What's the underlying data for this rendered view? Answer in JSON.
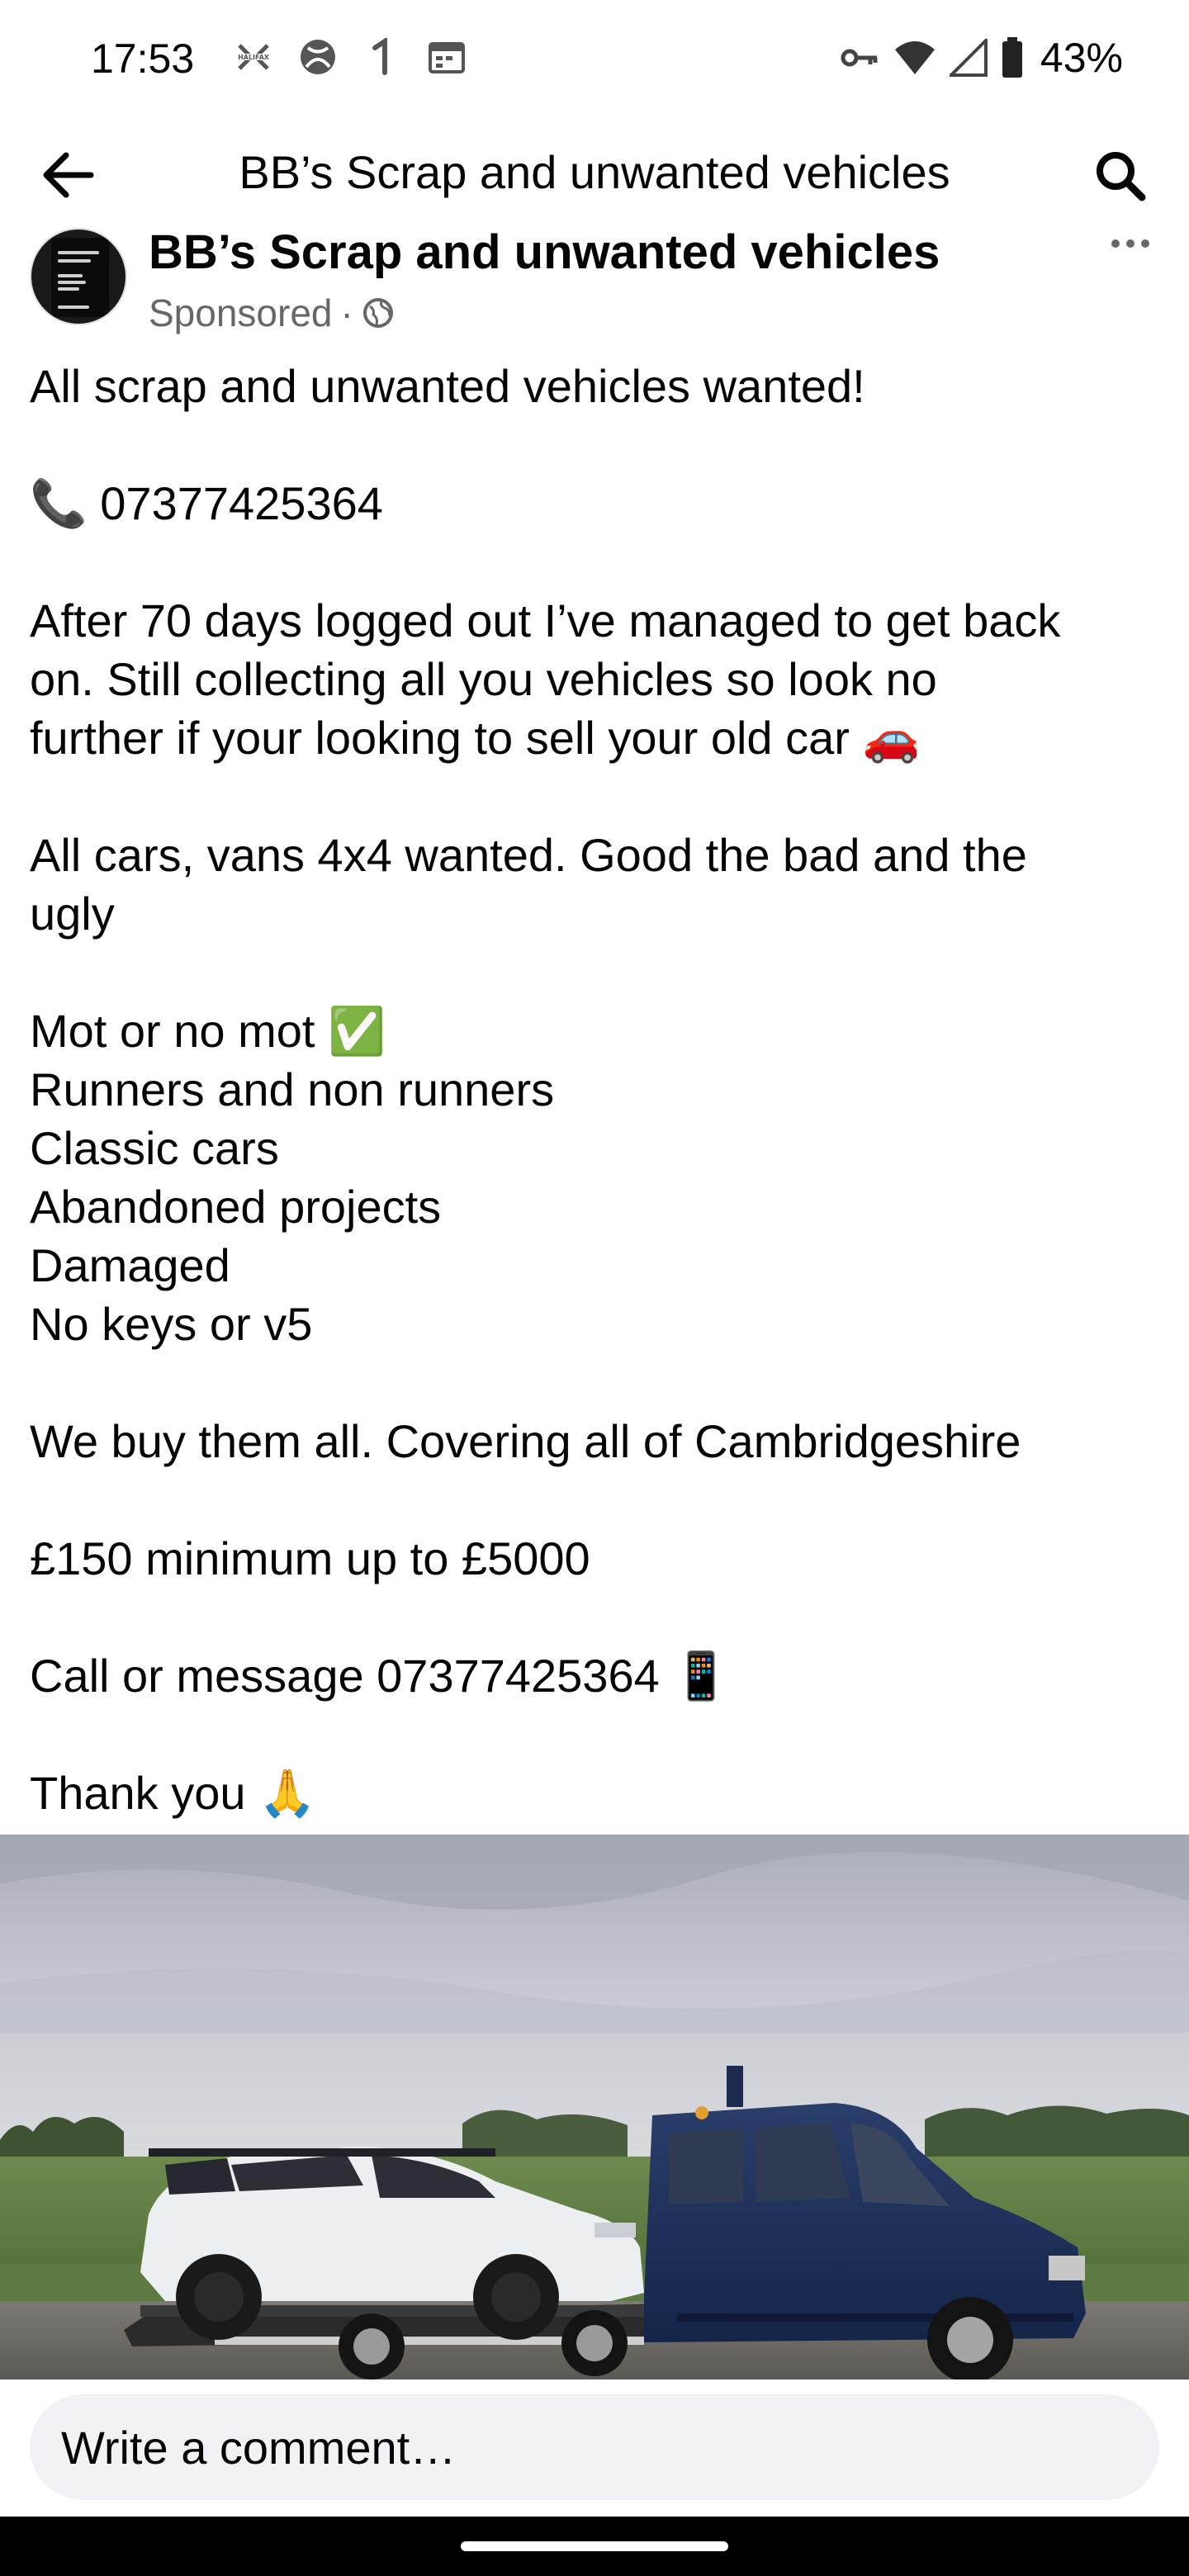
{
  "status_bar": {
    "time": "17:53",
    "left_icons": [
      "halifax-icon",
      "xbox-icon",
      "notification-icon",
      "calendar-icon"
    ],
    "right_icons": [
      "vpn-key-icon",
      "wifi-icon",
      "cell-signal-icon",
      "battery-icon"
    ],
    "battery_percent": "43%"
  },
  "header": {
    "title": "BB’s Scrap and unwanted vehicles"
  },
  "post": {
    "page_name": "BB’s Scrap and unwanted vehicles",
    "sponsored_label": "Sponsored",
    "separator": "·",
    "lines": [
      "All scrap and unwanted vehicles wanted!",
      "",
      "📞 07377425364",
      "",
      "After 70 days logged out I’ve managed to get back",
      "on. Still collecting all you vehicles so look no",
      "further if your looking to sell your old car 🚗",
      "",
      "All cars, vans 4x4 wanted. Good the bad and the",
      "ugly",
      "",
      "Mot or no mot ✅",
      "Runners and non runners",
      "Classic cars",
      "Abandoned projects",
      "Damaged",
      "No keys or v5",
      "",
      "We buy them all. Covering all of Cambridgeshire",
      "",
      "£150 minimum up to £5000",
      "",
      "Call or message 07377425364 📱",
      "",
      "Thank you 🙏"
    ]
  },
  "comment_bar": {
    "placeholder": "Write a comment…"
  },
  "colors": {
    "text": "#050505",
    "secondary_text": "#65676b",
    "comment_bg": "#f0f2f5",
    "van_blue": "#1c2f5a"
  }
}
